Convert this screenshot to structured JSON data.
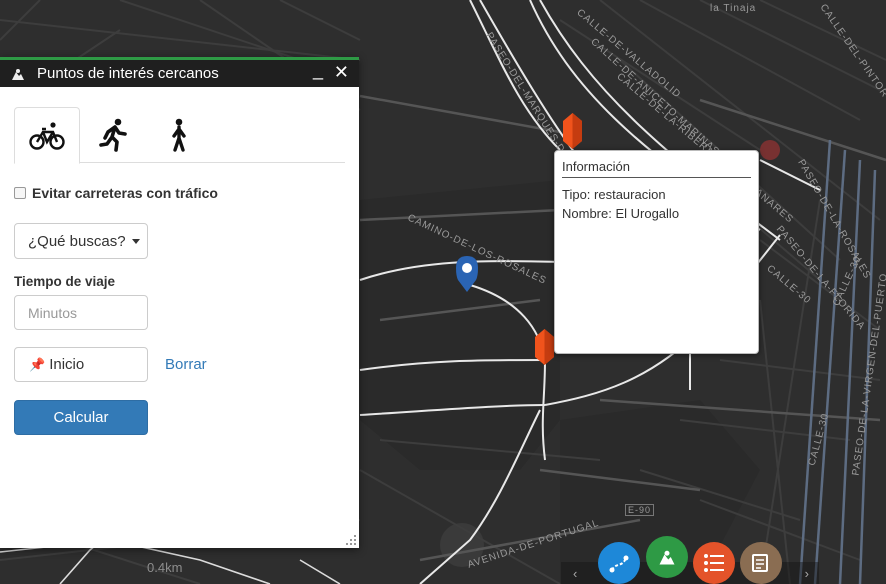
{
  "map": {
    "street_labels": [
      "CALLE-DE-VALLADOLID",
      "CALLE-DE-ANICETO-MARINAS",
      "CALLE-DE-LA-RIBERA-DE-MANZANARES",
      "PASEO-DE-LA-FLORIDA",
      "PASEO-DE-LA-ROSALES",
      "CALLE-DEL-PINTOR-ROSALES",
      "CALLE-30",
      "CALLE-30",
      "CALLE-30",
      "CAMINO-DE-LOS-ROSALES",
      "AVENIDA-DE-PORTUGAL",
      "PASEO-DE-LA-VIRGEN-DEL-PUERTO",
      "PASEO-DEL-MARQUES-DE-MONISTROL",
      "la Tinaja",
      "E-90"
    ],
    "scale_label": "0.4km"
  },
  "popup": {
    "title": "Información",
    "type_line": "Tipo: restauracion",
    "name_line": "Nombre: El Urogallo"
  },
  "panel": {
    "title": "Puntos de interés cercanos",
    "minimize": "_",
    "close": "✕",
    "tabs": [
      {
        "icon": "bicycle-icon",
        "active": true
      },
      {
        "icon": "running-icon",
        "active": false
      },
      {
        "icon": "walking-icon",
        "active": false
      }
    ],
    "avoid_traffic_label": "Evitar carreteras con tráfico",
    "search_dropdown": "¿Qué buscas?",
    "travel_time_label": "Tiempo de viaje",
    "minutes_placeholder": "Minutos",
    "start_button": "Inicio",
    "clear_link": "Borrar",
    "calculate_button": "Calcular"
  },
  "toolbar": {
    "buttons": [
      {
        "icon": "route-icon",
        "color": "#1e88d8"
      },
      {
        "icon": "map-pin-icon",
        "color": "#2e9a45"
      },
      {
        "icon": "list-icon",
        "color": "#e4532a"
      },
      {
        "icon": "notes-icon",
        "color": "#8a6d52"
      }
    ],
    "left_arrow": "‹",
    "right_arrow": "›"
  },
  "colors": {
    "accent_green": "#2e9a45",
    "primary_blue": "#337ab7",
    "poi_orange": "#f0531c",
    "marker_blue": "#2a64b4"
  }
}
